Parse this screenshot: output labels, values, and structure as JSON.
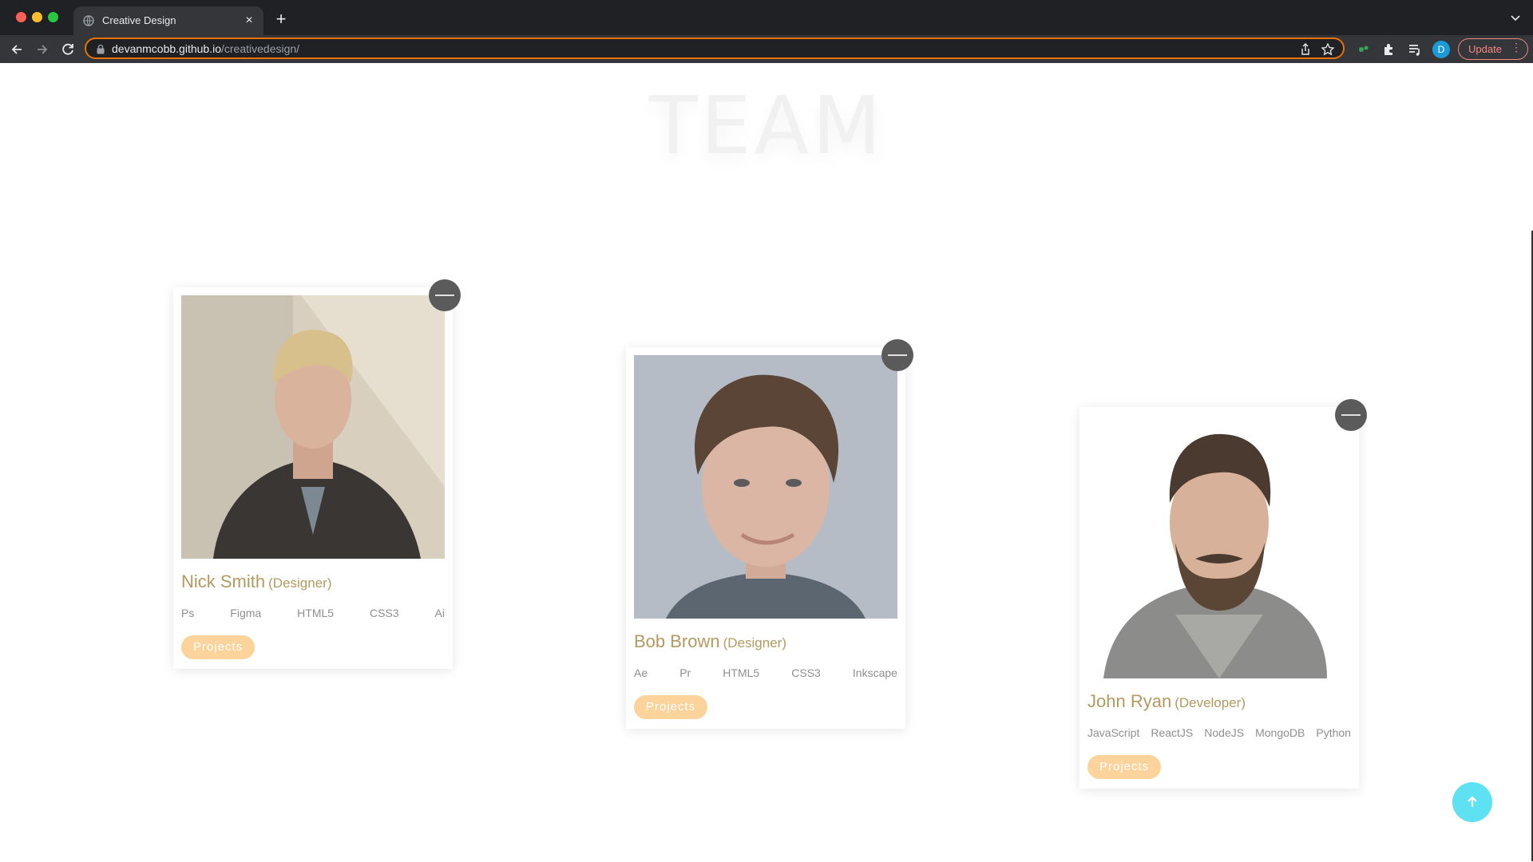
{
  "browser": {
    "tab_title": "Creative Design",
    "url_host": "devanmcobb.github.io",
    "url_path": "/creativedesign/",
    "profile_initial": "D",
    "update_label": "Update"
  },
  "page": {
    "title": "TEAM"
  },
  "team": [
    {
      "name": "Nick Smith",
      "role": "(Designer)",
      "skills": [
        "Ps",
        "Figma",
        "HTML5",
        "CSS3",
        "Ai"
      ],
      "button": "Projects"
    },
    {
      "name": "Bob Brown",
      "role": "(Designer)",
      "skills": [
        "Ae",
        "Pr",
        "HTML5",
        "CSS3",
        "Inkscape"
      ],
      "button": "Projects"
    },
    {
      "name": "John Ryan",
      "role": "(Developer)",
      "skills": [
        "JavaScript",
        "ReactJS",
        "NodeJS",
        "MongoDB",
        "Python"
      ],
      "button": "Projects"
    }
  ],
  "colors": {
    "accent_name": "#b39a60",
    "button_bg": "#fcd39a",
    "scroll_top_bg": "#5fe1f4",
    "omnibox_focus": "#e8710a"
  },
  "icons": {
    "scroll_top": "arrow-up-icon",
    "collapse": "minus-icon"
  }
}
